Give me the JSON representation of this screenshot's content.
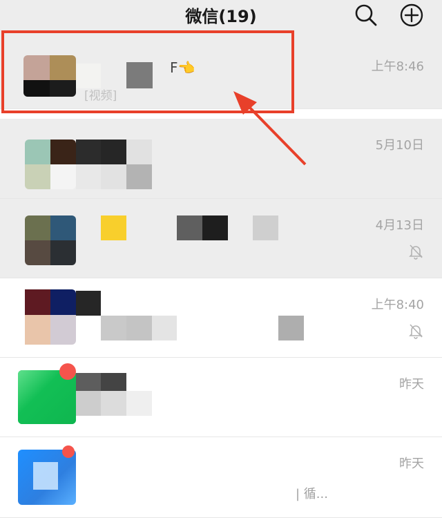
{
  "header": {
    "title": "微信(19)",
    "search_icon": "search-icon",
    "add_icon": "plus-circle-icon"
  },
  "chats": [
    {
      "time": "上午8:46",
      "snippet": "[视频]",
      "name_fragment": "F👈"
    },
    {
      "time": "5月10日"
    },
    {
      "time": "4月13日",
      "muted": true
    },
    {
      "time": "上午8:40",
      "muted": true
    },
    {
      "time": "昨天",
      "has_badge": true
    },
    {
      "time": "昨天",
      "has_badge": true,
      "snippet": "| 循..."
    }
  ],
  "colors": {
    "header_bg": "#ededed",
    "accent_red": "#e8402a",
    "time_text": "#a4a4a4",
    "badge": "#f5544c"
  }
}
